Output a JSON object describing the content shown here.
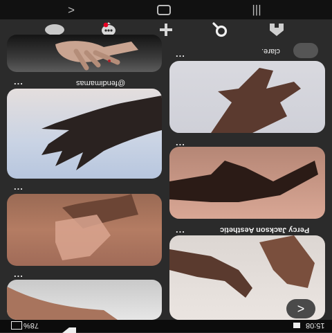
{
  "nav": {
    "back_glyph": "<",
    "home_glyph": "▭",
    "recent_glyph": "|||"
  },
  "tabs": [
    "profile",
    "messages",
    "create",
    "search",
    "home"
  ],
  "pins_left": [
    {
      "menu": "..."
    },
    {
      "caption": "@fendimamas",
      "menu": "..."
    },
    {
      "menu": "..."
    },
    {
      "menu": "..."
    }
  ],
  "pins_right": [
    {
      "caption": "clare.",
      "menu": "..."
    },
    {
      "menu": "..."
    },
    {
      "caption": "Percy Jackson Aesthetic",
      "menu": "..."
    }
  ],
  "fab_glyph": ">",
  "status": {
    "time": "15:08",
    "battery": "78%"
  },
  "colors": {
    "background": "#2b2b2b",
    "statusbar": "#0c0c0c",
    "accent_red": "#e60023"
  }
}
